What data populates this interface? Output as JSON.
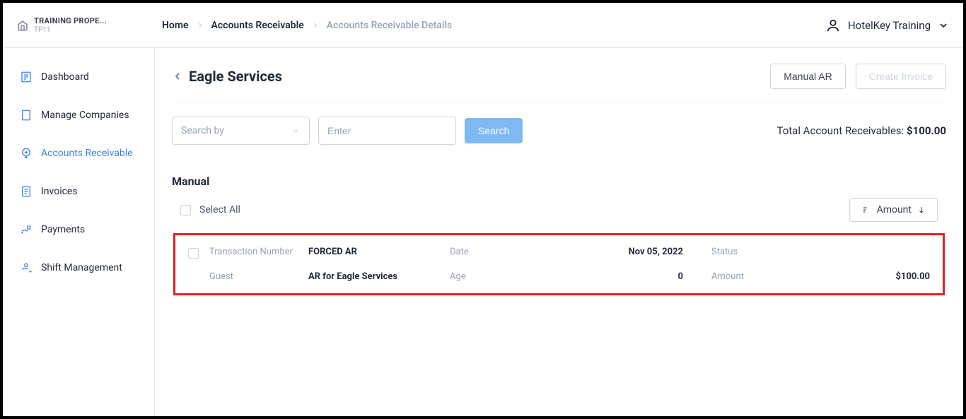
{
  "property": {
    "name": "TRAINING PROPE...",
    "code": "TP11"
  },
  "breadcrumb": {
    "home": "Home",
    "ar": "Accounts Receivable",
    "details": "Accounts Receivable Details"
  },
  "user": {
    "name": "HotelKey Training"
  },
  "sidebar": {
    "dashboard": "Dashboard",
    "manage_companies": "Manage Companies",
    "accounts_receivable": "Accounts Receivable",
    "invoices": "Invoices",
    "payments": "Payments",
    "shift_management": "Shift Management"
  },
  "page": {
    "title": "Eagle Services",
    "manual_ar_btn": "Manual AR",
    "create_invoice_btn": "Create Invoice"
  },
  "search": {
    "by_placeholder": "Search by",
    "enter_placeholder": "Enter",
    "button": "Search"
  },
  "totals": {
    "label": "Total Account Receivables: ",
    "amount": "$100.00"
  },
  "section": {
    "title": "Manual",
    "select_all": "Select All",
    "sort_label": "Amount"
  },
  "record": {
    "txn_label": "Transaction Number",
    "txn_value": "FORCED AR",
    "date_label": "Date",
    "date_value": "Nov 05, 2022",
    "status_label": "Status",
    "status_value": "",
    "guest_label": "Guest",
    "guest_value": "AR for Eagle Services",
    "age_label": "Age",
    "age_value": "0",
    "amount_label": "Amount",
    "amount_value": "$100.00"
  }
}
